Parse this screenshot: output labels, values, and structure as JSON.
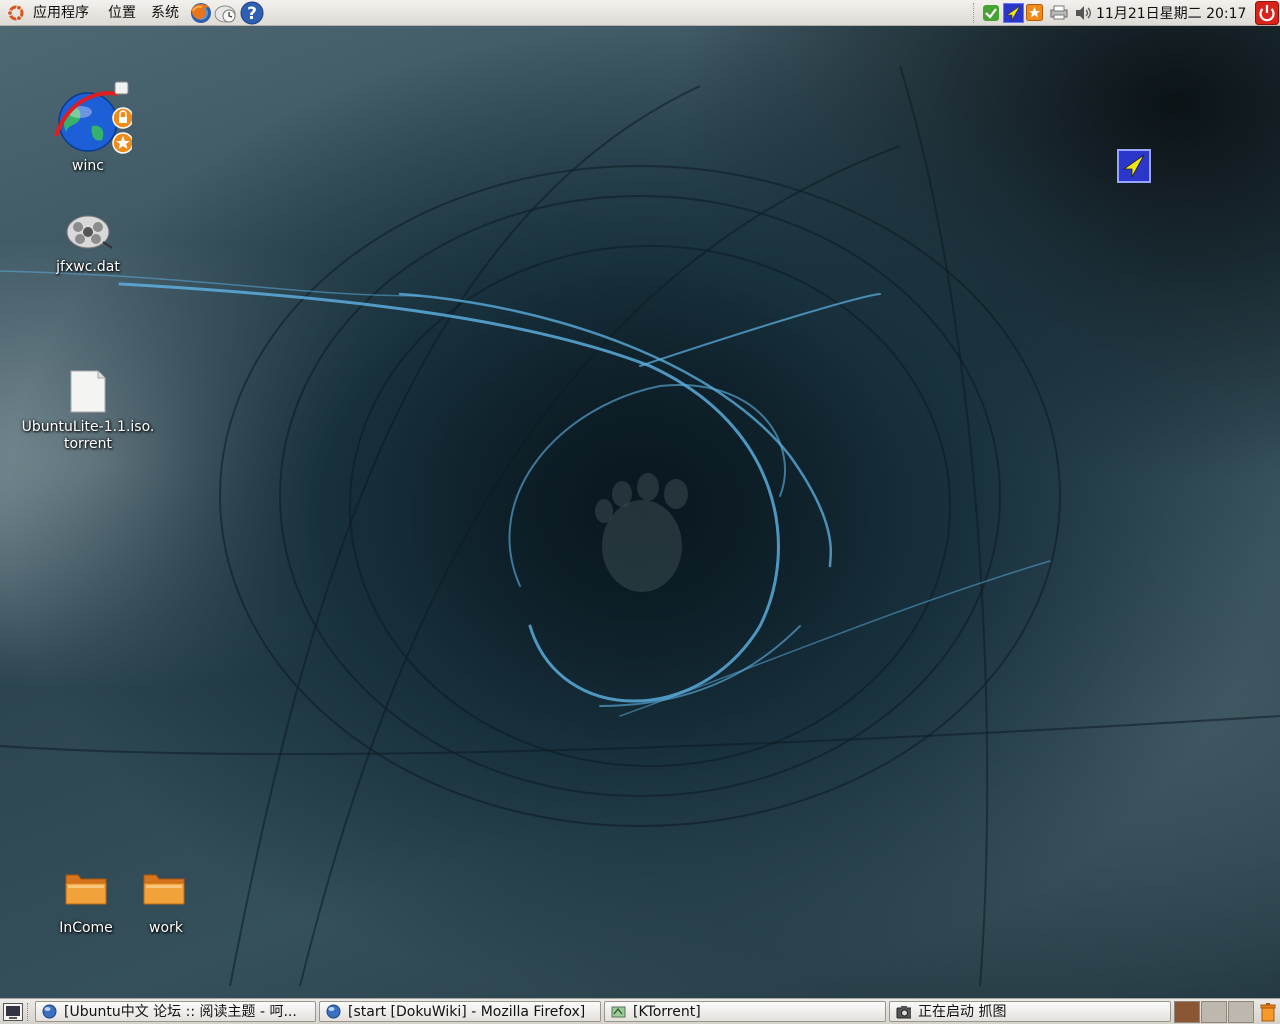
{
  "top_panel": {
    "menus": {
      "applications": "应用程序",
      "places": "位置",
      "system": "系统"
    },
    "launchers": [
      "firefox-icon",
      "evolution-clock-icon",
      "help-icon"
    ],
    "tray_icons": [
      "network-shield-icon",
      "arrow-app-icon",
      "update-notifier-icon",
      "printer-icon",
      "volume-icon"
    ],
    "clock": "11月21日星期二 20:17",
    "shutdown_icon": "power-icon"
  },
  "desktop": {
    "icons": {
      "winc": "winc",
      "jfxwc": "jfxwc.dat",
      "torrent_line1": "UbuntuLite-1.1.iso.",
      "torrent_line2": "torrent",
      "income": "InCome",
      "work": "work"
    }
  },
  "taskbar": {
    "tasks": [
      {
        "label": "[Ubuntu中文 论坛 :: 阅读主题 - 呵...",
        "icon": "firefox-globe-icon"
      },
      {
        "label": "[start [DokuWiki] - Mozilla Firefox]",
        "icon": "firefox-globe-icon"
      },
      {
        "label": "[KTorrent]",
        "icon": "ktorrent-icon"
      },
      {
        "label": "正在启动 抓图",
        "icon": "camera-icon"
      }
    ],
    "workspaces": 4
  },
  "colors": {
    "panel": "#e6e3de",
    "accent_orange": "#e07b24",
    "power_red": "#d9231a",
    "wallpaper_blue": "#4aa3d8"
  }
}
